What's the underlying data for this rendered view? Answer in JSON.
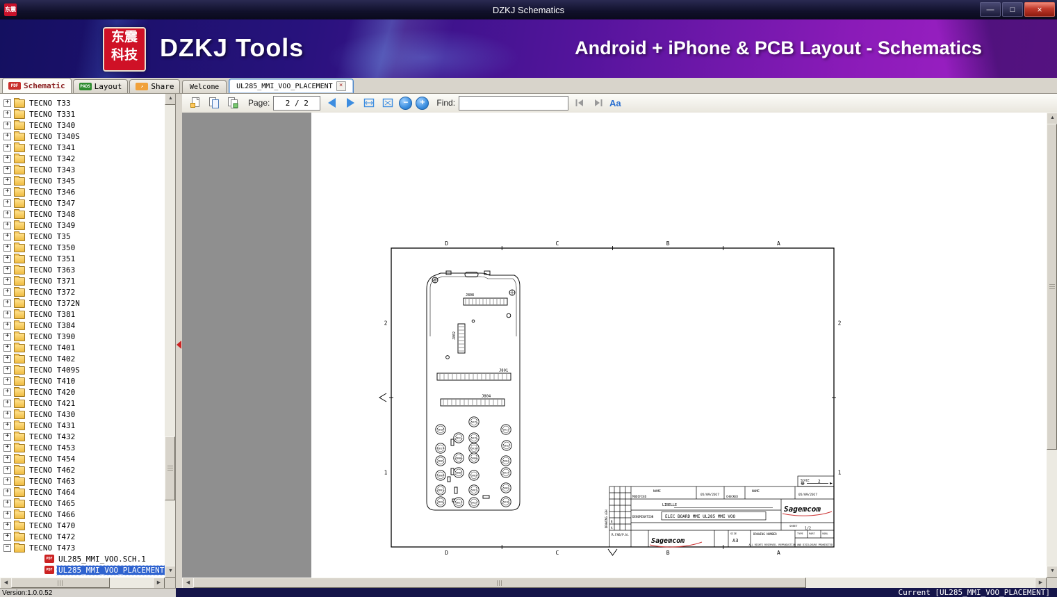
{
  "window": {
    "title": "DZKJ Schematics"
  },
  "icons": {
    "minimize": "—",
    "maximize": "□",
    "close": "×",
    "zoom_out": "−",
    "zoom_in": "+",
    "case": "Aa"
  },
  "banner": {
    "logo_top": "东震",
    "logo_bottom": "科技",
    "app_name": "DZKJ Tools",
    "tagline": "Android + iPhone & PCB Layout - Schematics"
  },
  "tabs": {
    "main": [
      {
        "label": "Schematic",
        "badge": "PDF",
        "badge_bg": "#c9302c",
        "active": true
      },
      {
        "label": "Layout",
        "badge": "PADS",
        "badge_bg": "#2e8b2e",
        "active": false
      },
      {
        "label": "Share",
        "badge": "↗",
        "badge_bg": "#f0a13a",
        "active": false
      }
    ],
    "documents": [
      {
        "label": "Welcome",
        "active": false,
        "closable": false
      },
      {
        "label": "UL285_MMI_VOO_PLACEMENT",
        "active": true,
        "closable": true
      }
    ]
  },
  "toolbar": {
    "page_label": "Page:",
    "page_value": "2 / 2",
    "find_label": "Find:",
    "find_value": ""
  },
  "sidebar": {
    "pdf_badge": "PDF",
    "expander_collapsed": "+",
    "expander_expanded": "−",
    "folders": [
      "TECNO T33",
      "TECNO T331",
      "TECNO T340",
      "TECNO T340S",
      "TECNO T341",
      "TECNO T342",
      "TECNO T343",
      "TECNO T345",
      "TECNO T346",
      "TECNO T347",
      "TECNO T348",
      "TECNO T349",
      "TECNO T35",
      "TECNO T350",
      "TECNO T351",
      "TECNO T363",
      "TECNO T371",
      "TECNO T372",
      "TECNO T372N",
      "TECNO T381",
      "TECNO T384",
      "TECNO T390",
      "TECNO T401",
      "TECNO T402",
      "TECNO T409S",
      "TECNO T410",
      "TECNO T420",
      "TECNO T421",
      "TECNO T430",
      "TECNO T431",
      "TECNO T432",
      "TECNO T453",
      "TECNO T454",
      "TECNO T462",
      "TECNO T463",
      "TECNO T464",
      "TECNO T465",
      "TECNO T466",
      "TECNO T470",
      "TECNO T472",
      "TECNO T473"
    ],
    "expanded_folder": "TECNO T473",
    "children": [
      {
        "label": "UL285_MMI_VOO.SCH.1",
        "selected": false
      },
      {
        "label": "UL285_MMI_VOO_PLACEMENT",
        "selected": true
      }
    ]
  },
  "statusbar": {
    "version": "Version:1.0.0.52",
    "current": "Current [UL285_MMI_VOO_PLACEMENT]"
  },
  "schematic": {
    "frame_columns": [
      "D",
      "C",
      "B",
      "A"
    ],
    "frame_rows": [
      "2",
      "1"
    ],
    "labels": {
      "j808": "J808",
      "j802": "J802",
      "j801": "J801",
      "j804": "J804"
    },
    "keypad": [
      [
        186,
        456,
        "5610"
      ],
      [
        234,
        445,
        "5615"
      ],
      [
        280,
        456,
        "5611"
      ],
      [
        212,
        468,
        "5613"
      ],
      [
        234,
        468,
        "5619"
      ],
      [
        186,
        483,
        "5617"
      ],
      [
        234,
        483,
        "5618"
      ],
      [
        281,
        479,
        "5612"
      ],
      [
        186,
        501,
        "5605"
      ],
      [
        212,
        497,
        "5606"
      ],
      [
        234,
        497,
        "5600"
      ],
      [
        280,
        501,
        "5604"
      ],
      [
        186,
        522,
        "5609"
      ],
      [
        212,
        518,
        "5608"
      ],
      [
        234,
        522,
        "5603"
      ],
      [
        280,
        518,
        "5614"
      ],
      [
        186,
        543,
        "5601"
      ],
      [
        234,
        543,
        "5607"
      ],
      [
        280,
        540,
        "5602"
      ],
      [
        186,
        560,
        "5620"
      ],
      [
        212,
        561,
        "5621"
      ],
      [
        234,
        561,
        "5622"
      ],
      [
        280,
        560,
        "5616"
      ]
    ],
    "titleblock": {
      "modified": "MODIFIED",
      "name1": "NAME",
      "date1": "05/09/2017",
      "checked": "CHECKED",
      "name2": "NAME",
      "date2": "05/09/2017",
      "libelle": "LIBELLE",
      "denomination_label": "DENOMINATION",
      "denomination": "ELEC BOARD MMI UL285 MMI VOO",
      "brand": "Sagemcom",
      "sheet_label": "SHEET",
      "sheet": "1/2",
      "rfab": "R.FAB/P.N.",
      "size_label": "SIZE",
      "size": "A3",
      "drawing_number": "DRAWING NUMBER",
      "type": "TYPE",
      "part": "PART",
      "vobl": "VOBL",
      "scale_label": "SCALE",
      "scale": "2",
      "drawing_side": "DRAWING A3H",
      "rev_b": "B",
      "rev_a": "A",
      "copyright": "ALL RIGHTS RESERVED. REPRODUCTION AND DISCLOSURE PROHIBITED"
    }
  }
}
